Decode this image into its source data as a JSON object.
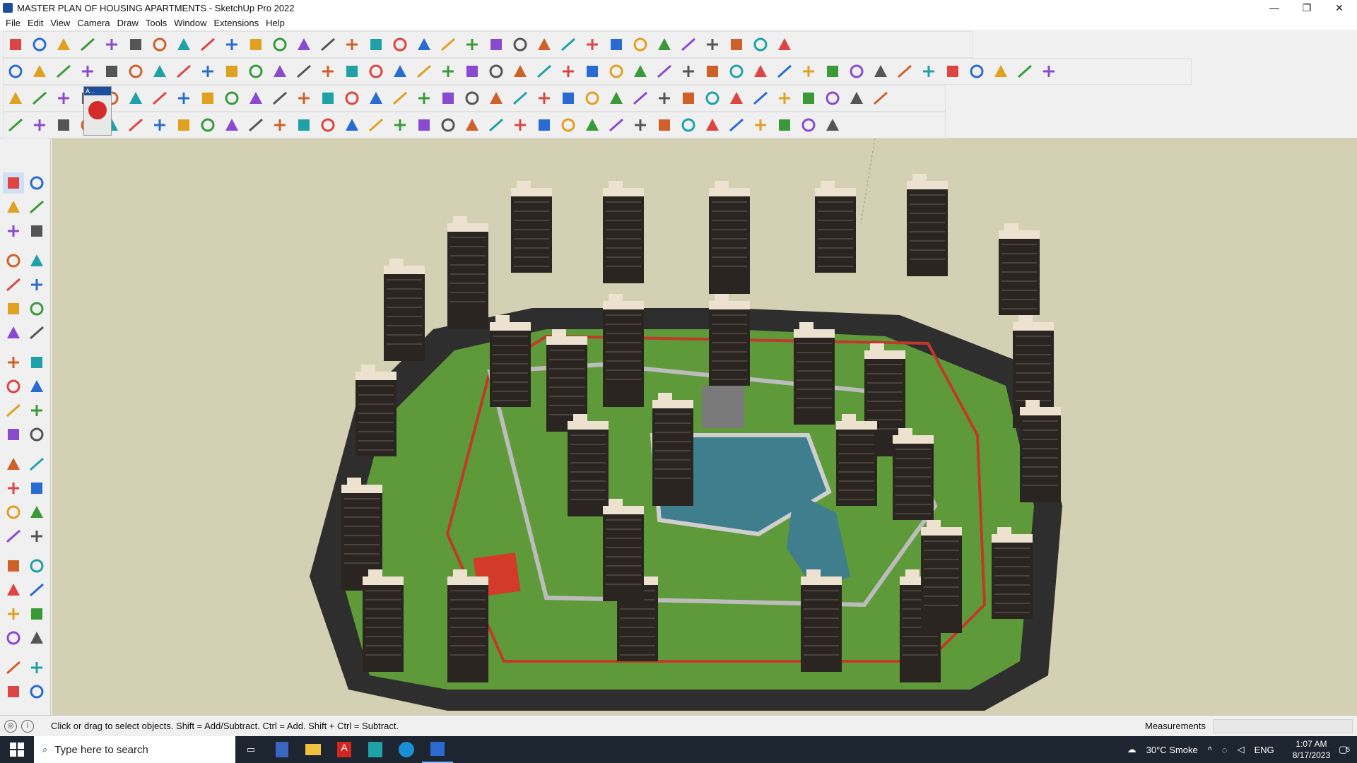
{
  "window": {
    "title": "MASTER PLAN OF HOUSING APARTMENTS - SketchUp Pro 2022",
    "minimize": "—",
    "restore": "❐",
    "close": "✕"
  },
  "menu": [
    "File",
    "Edit",
    "View",
    "Camera",
    "Draw",
    "Tools",
    "Window",
    "Extensions",
    "Help"
  ],
  "toolbars": {
    "row1": [
      "zoom-window",
      "select",
      "eraser",
      "line",
      "arc",
      "rectangle",
      "push-pull",
      "follow-me",
      "move",
      "rotate",
      "scale",
      "tape-measure",
      "text",
      "paint",
      "orbit",
      "pan",
      "zoom",
      "zoom-extents",
      "warehouse",
      "extension",
      "components",
      "section",
      "user",
      "styles",
      "layers",
      "tags",
      "sandbox",
      "flip",
      "intersect",
      "weld",
      "undo",
      "redo",
      "fredo"
    ],
    "row2": [
      "box",
      "shade",
      "solid",
      "push",
      "extrude-a",
      "extrude-b",
      "extrude-c",
      "extrude-d",
      "extrude-e",
      "extrude-f",
      "curve",
      "plane-a",
      "plane-b",
      "plane-c",
      "terrain-a",
      "terrain-b",
      "house-a",
      "house-b",
      "house-c",
      "house-d",
      "house-e",
      "house-f",
      "fe-tool",
      "tape",
      "pencil",
      "round-a",
      "round-b",
      "round-c",
      "round-d",
      "round-e",
      "round-f",
      "round-g",
      "round-h",
      "round-i",
      "round-j",
      "bezier",
      "eraser-b",
      "shape-a",
      "shape-b",
      "shape-c",
      "shape-d",
      "shape-e",
      "shape-f",
      "shape-g"
    ],
    "row3": [
      "solid-a",
      "solid-b",
      "solid-c",
      "solid-d",
      "undo-curve",
      "red-square",
      "frame-a",
      "frame-b",
      "box-a",
      "chain",
      "edge",
      "spline",
      "cross-red",
      "cross-green",
      "cross-blue",
      "cone",
      "cone-b",
      "triangle",
      "loop-a",
      "loop-b",
      "loop-c",
      "star",
      "cube-a",
      "hook",
      "tree",
      "cube-b",
      "cube-c",
      "cube-d",
      "cube-e",
      "pattern-a",
      "pattern-b",
      "grid-a",
      "grid-b",
      "grid-c",
      "dots",
      "arc-dots",
      "node"
    ],
    "row4": [
      "path-a",
      "path-b",
      "path-c",
      "shape-tool",
      "clock",
      "hand",
      "rotate-b",
      "rotate-c",
      "fillet-a",
      "fillet-b",
      "fillet-c",
      "line-red",
      "curve-red",
      "roof-a",
      "roof-b",
      "bars-a",
      "bars-b",
      "bars-c",
      "bars-d",
      "bars-e",
      "bars-f",
      "bars-g",
      "bars-h",
      "bars-i",
      "bars-j",
      "bars-k",
      "bars-l",
      "bars-m",
      "bars-n",
      "bars-o",
      "bars-p",
      "bars-q",
      "bars-r",
      "bars-s",
      "bars-t"
    ],
    "floating": {
      "label": "A..."
    }
  },
  "status": {
    "hint": "Click or drag to select objects. Shift = Add/Subtract. Ctrl = Add. Shift + Ctrl = Subtract.",
    "measurements_label": "Measurements",
    "measurements_value": ""
  },
  "taskbar": {
    "search_placeholder": "Type here to search",
    "weather": "30°C  Smoke",
    "lang": "ENG",
    "time": "1:07 AM",
    "date": "8/17/2023",
    "notifications": "5"
  },
  "colors": {
    "sky": "#d4d0b3",
    "grass": "#5f9a3a",
    "water": "#3f7e8c",
    "road": "#3a3a3a",
    "tower": "#ede2d0",
    "red_path": "#c0392b"
  }
}
